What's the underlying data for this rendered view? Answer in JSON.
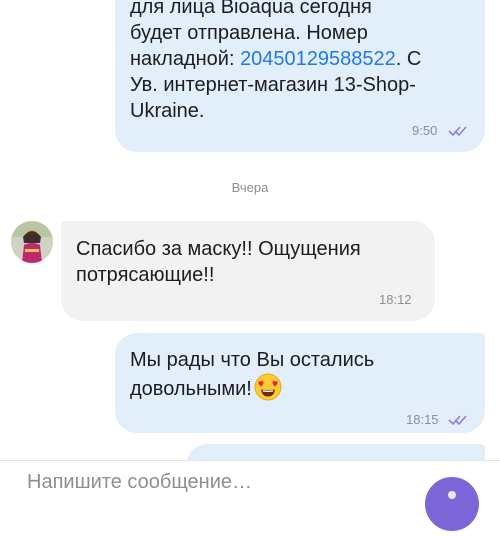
{
  "messages": [
    {
      "direction": "outgoing",
      "lines": [
        "для лица Bioaqua сегодня",
        "будет отправлена. Номер"
      ],
      "waybill_prefix": "накладной: ",
      "waybill_number": "20450129588522",
      "waybill_suffix": ".  С",
      "tail_lines": [
        "Ув. интернет-магазин 13-Shop-",
        "Ukraine."
      ],
      "time": "9:50",
      "read_status": "read-double-check-icon"
    },
    {
      "direction": "incoming",
      "lines": [
        "Спасибо за маску!! Ощущения",
        "потрясающие!!"
      ],
      "time": "18:12"
    },
    {
      "direction": "outgoing",
      "lines": [
        "Мы рады что Вы остались",
        "довольными!"
      ],
      "emoji": "😍",
      "time": "18:15",
      "read_status": "read-double-check-icon"
    }
  ],
  "date_separator": "Вчера",
  "composer": {
    "placeholder": "Напишите сообщение…",
    "send_icon": "send-icon"
  },
  "colors": {
    "outgoing_bubble": "#e3eefb",
    "incoming_bubble": "#f2f2f2",
    "link": "#1f7be3",
    "accent": "#7d66d8"
  }
}
